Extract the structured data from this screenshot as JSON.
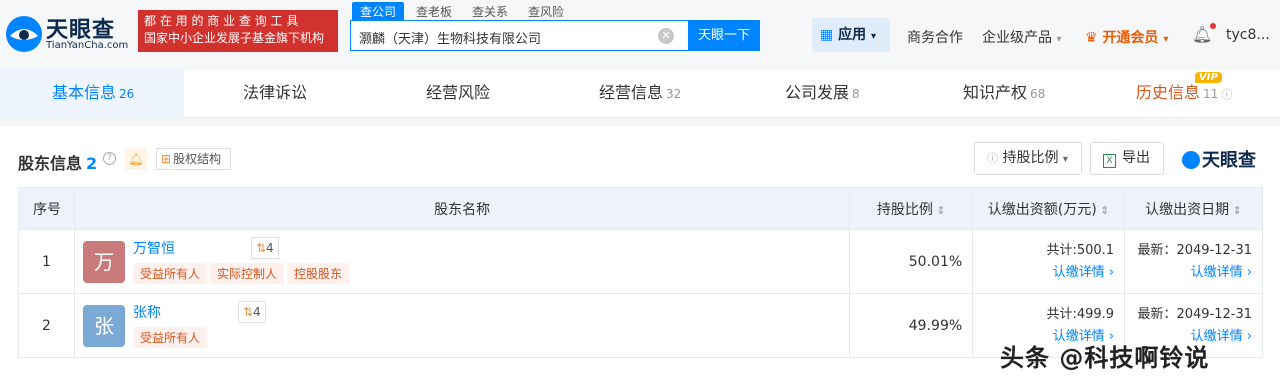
{
  "header": {
    "logo_text": "天眼查",
    "logo_sub": "TianYanCha.com",
    "slogan_line1": "都 在 用 的 商 业 查 询 工 具",
    "slogan_line2": "国家中小企业发展子基金旗下机构",
    "search_tabs": [
      "查公司",
      "查老板",
      "查关系",
      "查风险"
    ],
    "search_value": "灏麟（天津）生物科技有限公司",
    "search_button": "天眼一下",
    "app_button": "应用",
    "nav": [
      "商务合作",
      "企业级产品",
      "开通会员",
      "tyc8..."
    ]
  },
  "tabs": [
    {
      "label": "基本信息",
      "count": "26"
    },
    {
      "label": "法律诉讼",
      "count": ""
    },
    {
      "label": "经营风险",
      "count": ""
    },
    {
      "label": "经营信息",
      "count": "32"
    },
    {
      "label": "公司发展",
      "count": "8"
    },
    {
      "label": "知识产权",
      "count": "68"
    },
    {
      "label": "历史信息",
      "count": "11"
    }
  ],
  "vip_badge": "VIP",
  "section": {
    "title": "股东信息",
    "count": "2",
    "equity_label": "股权结构",
    "ratio_label": "持股比例",
    "export_label": "导出",
    "brand": "天眼查"
  },
  "table": {
    "headers": [
      "序号",
      "股东名称",
      "持股比例",
      "认缴出资额(万元)",
      "认缴出资日期"
    ],
    "rows": [
      {
        "index": "1",
        "avatar": "万",
        "avatar_color": "#c97b7b",
        "name": "万智恒",
        "link_count": "4",
        "tags": [
          "受益所有人",
          "实际控制人",
          "控股股东"
        ],
        "ratio": "50.01%",
        "amount": "共计:500.1",
        "amount_link": "认缴详情 ›",
        "date": "最新：2049-12-31",
        "date_link": "认缴详情 ›"
      },
      {
        "index": "2",
        "avatar": "张",
        "avatar_color": "#7aa9d6",
        "name": "张称",
        "link_count": "4",
        "tags": [
          "受益所有人"
        ],
        "ratio": "49.99%",
        "amount": "共计:499.9",
        "amount_link": "认缴详情 ›",
        "date": "最新：2049-12-31",
        "date_link": "认缴详情 ›"
      }
    ]
  },
  "watermark": "头条 @科技啊铃说"
}
